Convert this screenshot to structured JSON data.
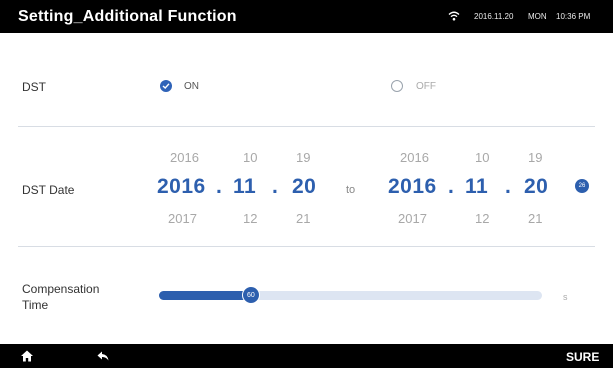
{
  "header": {
    "title": "Setting_Additional Function",
    "wifi_icon": "wifi-icon",
    "date": "2016.11.20",
    "day": "MON",
    "time": "10:36 PM"
  },
  "dst": {
    "label": "DST",
    "options": [
      {
        "label": "ON",
        "selected": true
      },
      {
        "label": "OFF",
        "selected": false
      }
    ]
  },
  "dst_date": {
    "label": "DST Date",
    "separator": "to",
    "start": {
      "above": {
        "year": "2016",
        "month": "10",
        "day": "19"
      },
      "selected": {
        "year": "2016",
        "month": "11",
        "day": "20"
      },
      "below": {
        "year": "2017",
        "month": "12",
        "day": "21"
      }
    },
    "end": {
      "above": {
        "year": "2016",
        "month": "10",
        "day": "19"
      },
      "selected": {
        "year": "2016",
        "month": "11",
        "day": "20"
      },
      "below": {
        "year": "2017",
        "month": "12",
        "day": "21"
      }
    },
    "dot_separator": ".",
    "confirm_badge": "26"
  },
  "compensation": {
    "label_line1": "Compensation",
    "label_line2": "Time",
    "value": "60",
    "fraction": 0.24,
    "unit": "s"
  },
  "footer": {
    "home_icon": "home-icon",
    "back_icon": "back-arrow-icon",
    "confirm_label": "SURE"
  },
  "colors": {
    "accent": "#2d5fae",
    "bar": "#000000",
    "track": "#dde5f2"
  }
}
